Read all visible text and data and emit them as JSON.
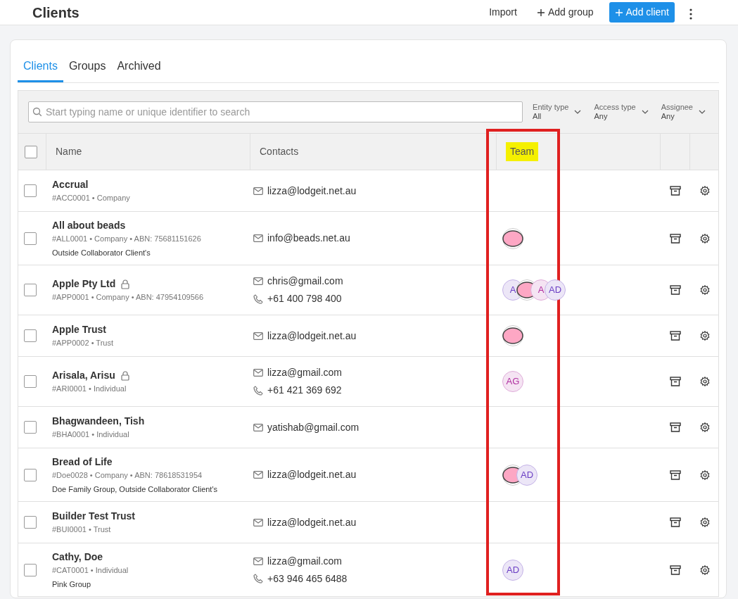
{
  "header": {
    "title": "Clients",
    "actions": [
      {
        "kind": "link",
        "label": "Import"
      },
      {
        "kind": "add",
        "label": "Add group"
      },
      {
        "kind": "primary",
        "label": "Add client"
      }
    ]
  },
  "tabs": [
    {
      "label": "Clients",
      "selected": true
    },
    {
      "label": "Groups",
      "selected": false
    },
    {
      "label": "Archived",
      "selected": false
    }
  ],
  "search": {
    "placeholder": "Start typing name or unique identifier to search"
  },
  "filters": [
    {
      "label": "Entity type",
      "value": "All"
    },
    {
      "label": "Access type",
      "value": "Any"
    },
    {
      "label": "Assignee",
      "value": "Any"
    }
  ],
  "table": {
    "select_all": {
      "checked": false
    },
    "columns": [
      {
        "label": "Name",
        "highlighted": false
      },
      {
        "label": "Contacts",
        "highlighted": false
      },
      {
        "label": "Team",
        "highlighted": true
      }
    ],
    "rows": [
      {
        "selected": false,
        "name": "Accrual",
        "locked": false,
        "meta": "#ACC0001 • Company",
        "contacts": [
          {
            "kind": "email",
            "text": "lizza@lodgeit.net.au"
          }
        ],
        "team": []
      },
      {
        "selected": false,
        "name": "All about beads",
        "locked": false,
        "meta": "#ALL0001 • Company • ABN: 75681151626",
        "groups": "Outside Collaborator Client's",
        "contacts": [
          {
            "kind": "email",
            "text": "info@beads.net.au"
          }
        ],
        "team": [
          {
            "kind": "image"
          }
        ]
      },
      {
        "selected": false,
        "name": "Apple Pty Ltd",
        "locked": true,
        "meta": "#APP0001 • Company • ABN: 47954109566",
        "contacts": [
          {
            "kind": "email",
            "text": "chris@gmail.com"
          },
          {
            "kind": "phone",
            "text": "+61 400 798 400"
          }
        ],
        "team": [
          {
            "kind": "initials",
            "text": "A",
            "color": "#6b3fc4"
          },
          {
            "kind": "image"
          },
          {
            "kind": "initials",
            "text": "A",
            "color": "#b02fa0"
          },
          {
            "kind": "initials",
            "text": "AD",
            "color": "#6b3fc4"
          }
        ]
      },
      {
        "selected": false,
        "name": "Apple Trust",
        "locked": false,
        "meta": "#APP0002 • Trust",
        "contacts": [
          {
            "kind": "email",
            "text": "lizza@lodgeit.net.au"
          }
        ],
        "team": [
          {
            "kind": "image"
          }
        ]
      },
      {
        "selected": false,
        "name": "Arisala, Arisu",
        "locked": true,
        "meta": "#ARI0001 • Individual",
        "contacts": [
          {
            "kind": "email",
            "text": "lizza@gmail.com"
          },
          {
            "kind": "phone",
            "text": "+61 421 369 692"
          }
        ],
        "team": [
          {
            "kind": "initials",
            "text": "AG",
            "color": "#b02fa0"
          }
        ]
      },
      {
        "selected": false,
        "name": "Bhagwandeen, Tish",
        "locked": false,
        "meta": "#BHA0001 • Individual",
        "contacts": [
          {
            "kind": "email",
            "text": "yatishab@gmail.com"
          }
        ],
        "team": []
      },
      {
        "selected": false,
        "name": "Bread of Life",
        "locked": false,
        "meta": "#Doe0028 • Company • ABN: 78618531954",
        "groups": "Doe Family Group, Outside Collaborator Client's",
        "contacts": [
          {
            "kind": "email",
            "text": "lizza@lodgeit.net.au"
          }
        ],
        "team": [
          {
            "kind": "image"
          },
          {
            "kind": "initials",
            "text": "AD",
            "color": "#6b3fc4"
          }
        ]
      },
      {
        "selected": false,
        "name": "Builder Test Trust",
        "locked": false,
        "meta": "#BUI0001 • Trust",
        "contacts": [
          {
            "kind": "email",
            "text": "lizza@lodgeit.net.au"
          }
        ],
        "team": []
      },
      {
        "selected": false,
        "name": "Cathy, Doe",
        "locked": false,
        "meta": "#CAT0001 • Individual",
        "groups": "Pink Group",
        "contacts": [
          {
            "kind": "email",
            "text": "lizza@gmail.com"
          },
          {
            "kind": "phone",
            "text": "+63 946 465 6488"
          }
        ],
        "team": [
          {
            "kind": "initials",
            "text": "AD",
            "color": "#6b3fc4"
          }
        ]
      }
    ]
  }
}
